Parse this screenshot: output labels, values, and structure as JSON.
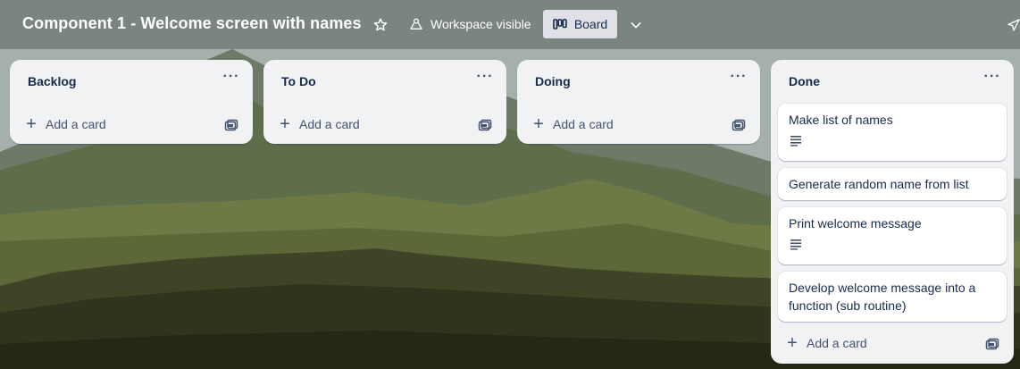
{
  "board": {
    "title": "Component 1 - Welcome screen with names",
    "visibility_label": "Workspace visible",
    "view_label": "Board"
  },
  "icons": {
    "star": "star-icon",
    "visibility": "people-icon",
    "board_view": "board-view-icon",
    "chevron": "chevron-down-icon",
    "share": "send-icon",
    "menu": "more-icon",
    "add": "plus-icon",
    "template": "card-template-icon",
    "description": "description-icon"
  },
  "colors": {
    "list_bg": "#f1f2f4",
    "card_bg": "#ffffff",
    "text": "#172b4d",
    "subtle": "#44546f",
    "board_button_bg": "#dfe1e6"
  },
  "lists": [
    {
      "title": "Backlog",
      "menu": "···",
      "add_label": "Add a card",
      "cards": []
    },
    {
      "title": "To Do",
      "menu": "···",
      "add_label": "Add a card",
      "cards": []
    },
    {
      "title": "Doing",
      "menu": "···",
      "add_label": "Add a card",
      "cards": []
    },
    {
      "title": "Done",
      "menu": "···",
      "add_label": "Add a card",
      "cards": [
        {
          "title": "Make list of names",
          "has_description": true
        },
        {
          "title": "Generate random name from list",
          "has_description": false
        },
        {
          "title": "Print welcome message",
          "has_description": true
        },
        {
          "title": "Develop welcome message into a function (sub routine)",
          "has_description": false
        }
      ]
    }
  ]
}
